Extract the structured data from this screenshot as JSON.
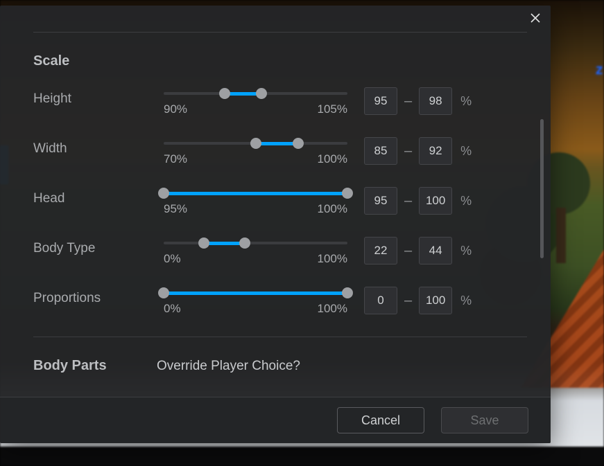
{
  "scene": {
    "badge": "Z"
  },
  "modal": {
    "section_title": "Scale",
    "unit": "%",
    "dash": "–",
    "rows": [
      {
        "label": "Height",
        "range_min": 90,
        "range_max": 105,
        "low": 95,
        "high": 98
      },
      {
        "label": "Width",
        "range_min": 70,
        "range_max": 100,
        "low": 85,
        "high": 92
      },
      {
        "label": "Head",
        "range_min": 95,
        "range_max": 100,
        "low": 95,
        "high": 100
      },
      {
        "label": "Body Type",
        "range_min": 0,
        "range_max": 100,
        "low": 22,
        "high": 44
      },
      {
        "label": "Proportions",
        "range_min": 0,
        "range_max": 100,
        "low": 0,
        "high": 100
      }
    ],
    "body_parts": {
      "title": "Body Parts",
      "question": "Override Player Choice?"
    },
    "footer": {
      "cancel": "Cancel",
      "save": "Save"
    },
    "scroll": {
      "thumb_top_pct": 24,
      "thumb_height_pct": 38
    }
  }
}
